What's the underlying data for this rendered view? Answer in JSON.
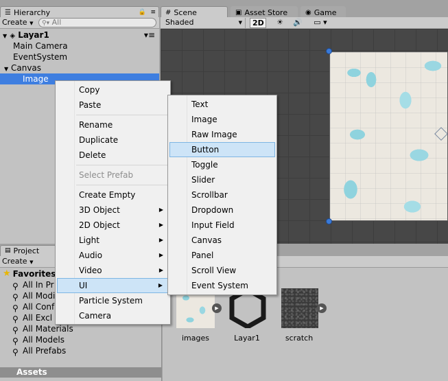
{
  "hierarchy": {
    "tab_label": "Hierarchy",
    "create_label": "Create",
    "search_placeholder": "All",
    "scene_name": "Layar1",
    "items": [
      "Main Camera",
      "EventSystem",
      "Canvas",
      "Image"
    ]
  },
  "scene": {
    "tabs": [
      "Scene",
      "Asset Store",
      "Game"
    ],
    "shading_mode": "Shaded",
    "mode_2d": "2D"
  },
  "project": {
    "tab_label": "Project",
    "create_label": "Create",
    "favorites_label": "Favorites",
    "favorites": [
      "All In Pr",
      "All Modi",
      "All Conf",
      "All Excl",
      "All Materials",
      "All Models",
      "All Prefabs"
    ],
    "assets_label": "Assets",
    "assets": [
      "images",
      "Layar1",
      "scratch"
    ]
  },
  "context_menu": {
    "items": [
      {
        "label": "Copy"
      },
      {
        "label": "Paste"
      },
      {
        "label": "Rename"
      },
      {
        "label": "Duplicate"
      },
      {
        "label": "Delete"
      },
      {
        "label": "Select Prefab"
      },
      {
        "label": "Create Empty"
      },
      {
        "label": "3D Object"
      },
      {
        "label": "2D Object"
      },
      {
        "label": "Light"
      },
      {
        "label": "Audio"
      },
      {
        "label": "Video"
      },
      {
        "label": "UI"
      },
      {
        "label": "Particle System"
      },
      {
        "label": "Camera"
      }
    ],
    "submenu_arrow": "▶"
  },
  "ui_submenu": {
    "items": [
      "Text",
      "Image",
      "Raw Image",
      "Button",
      "Toggle",
      "Slider",
      "Scrollbar",
      "Dropdown",
      "Input Field",
      "Canvas",
      "Panel",
      "Scroll View",
      "Event System"
    ],
    "highlighted": "Button"
  },
  "colors": {
    "selection_blue": "#3e7ee0",
    "menu_highlight": "#cde4f7",
    "panel_gray": "#c2c2c2",
    "scene_dark": "#474747"
  }
}
